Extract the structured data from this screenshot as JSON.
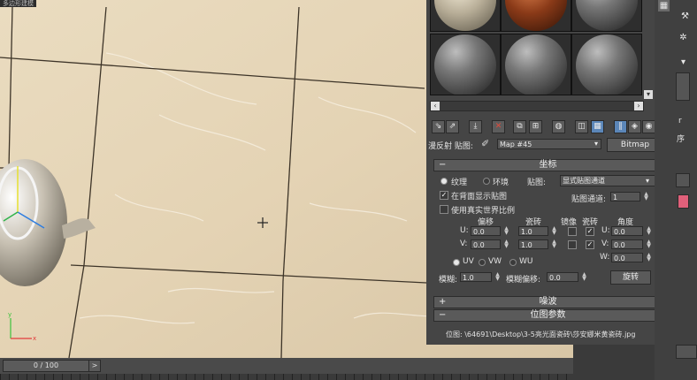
{
  "viewport": {
    "title": "多边形建模"
  },
  "timeline": {
    "frame_label": "0 / 100",
    "next_label": ">"
  },
  "material_editor": {
    "map_row": {
      "label": "漫反射 贴图:",
      "map_name": "Map #45",
      "map_type": "Bitmap"
    },
    "coords": {
      "title": "坐标",
      "texture_label": "纹理",
      "environ_label": "环境",
      "mapping_label": "贴图:",
      "mapping_value": "显式贴图通道",
      "show_map_back": "在背面显示贴图",
      "map_channel_label": "贴图通道:",
      "map_channel_value": "1",
      "use_real_world": "使用真实世界比例",
      "col_offset": "偏移",
      "col_tiling": "瓷砖",
      "col_mirror": "镜像",
      "col_tile": "瓷砖",
      "col_angle": "角度",
      "u_label": "U:",
      "v_label": "V:",
      "w_label": "W:",
      "u_offset": "0.0",
      "v_offset": "0.0",
      "u_tiling": "1.0",
      "v_tiling": "1.0",
      "u_angle": "0.0",
      "v_angle": "0.0",
      "w_angle": "0.0",
      "uv_label": "UV",
      "vw_label": "VW",
      "wu_label": "WU",
      "blur_label": "模糊:",
      "blur_value": "1.0",
      "blur_offset_label": "模糊偏移:",
      "blur_offset_value": "0.0",
      "rotate_button": "旋转"
    },
    "noise": {
      "title": "噪波"
    },
    "bitmap_params": {
      "title": "位图参数",
      "bitmap_path": "位图: \\64691\\Desktop\\3-5亮光面瓷砖\\莎安娜米黄瓷砖.jpg"
    }
  },
  "command_panel": {
    "label_fragment_1": "r",
    "label_fragment_2": "序"
  }
}
